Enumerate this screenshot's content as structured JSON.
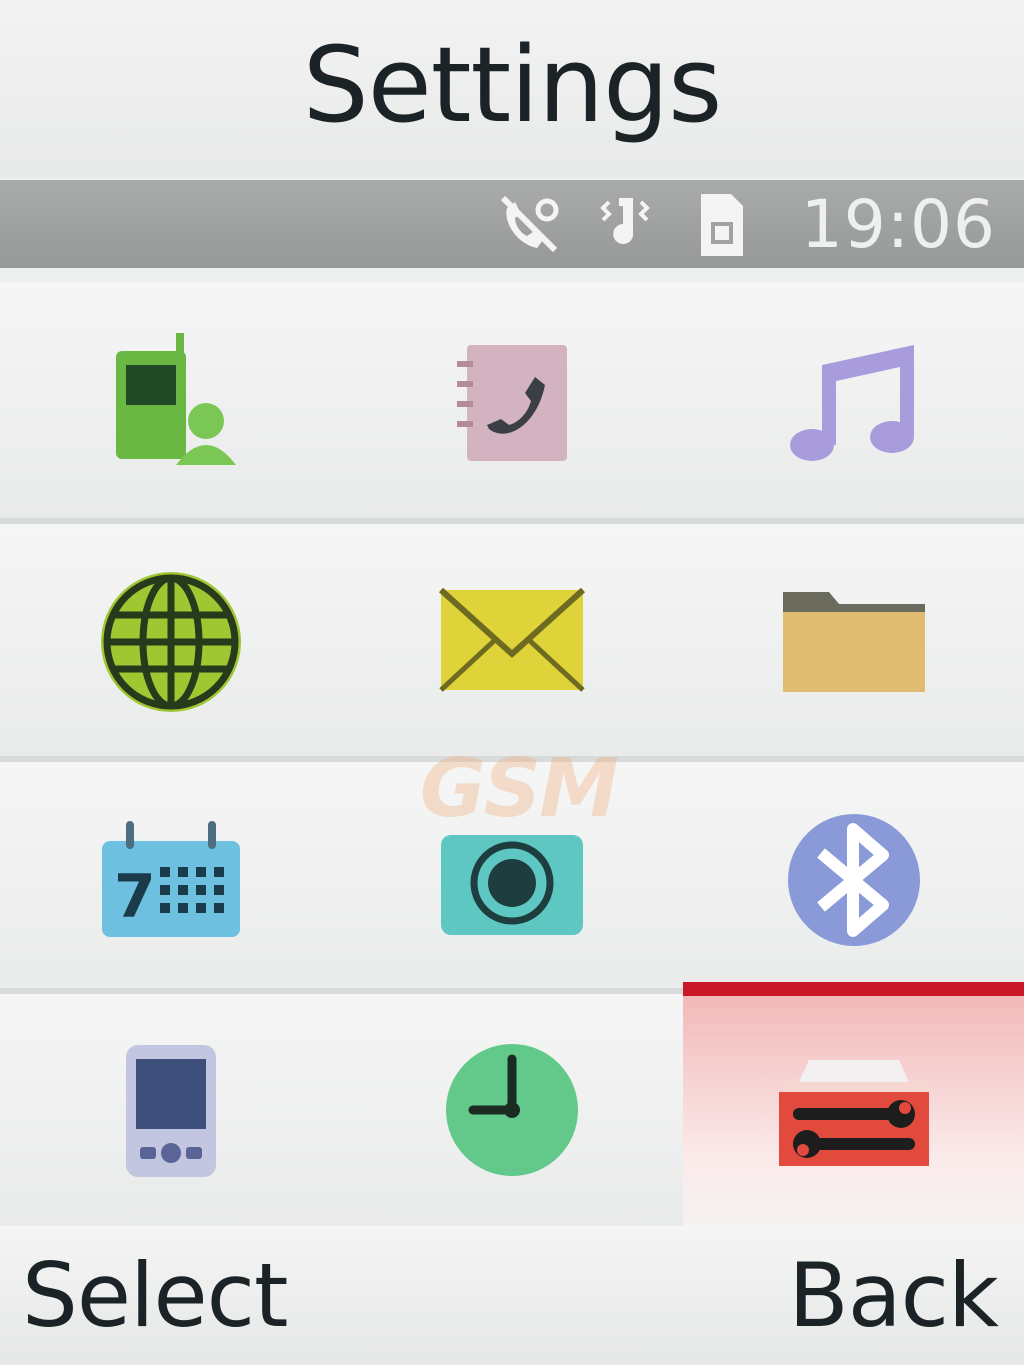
{
  "header": {
    "title": "Settings"
  },
  "status": {
    "time": "19:06",
    "icons": [
      "missed-call-icon",
      "vibrate-icon",
      "sim-card-icon"
    ]
  },
  "menu": {
    "items": [
      {
        "name": "phone-contacts-icon",
        "color": "#5fae3a"
      },
      {
        "name": "call-log-icon",
        "color": "#c9a0b0"
      },
      {
        "name": "music-icon",
        "color": "#9b8fd0"
      },
      {
        "name": "internet-globe-icon",
        "color": "#8fb82a"
      },
      {
        "name": "messages-envelope-icon",
        "color": "#d9cc2e"
      },
      {
        "name": "folder-icon",
        "color": "#d8b36a"
      },
      {
        "name": "calendar-icon",
        "color": "#5ab4d6"
      },
      {
        "name": "camera-icon",
        "color": "#56c3bf"
      },
      {
        "name": "bluetooth-icon",
        "color": "#8f9fd8"
      },
      {
        "name": "applications-icon",
        "color": "#5b66b0"
      },
      {
        "name": "clock-icon",
        "color": "#55c27b"
      },
      {
        "name": "settings-toolbox-icon",
        "color": "#e0483c"
      }
    ],
    "selected_index": 11,
    "selection_color": "#c8182a"
  },
  "watermark": "GSM",
  "softkeys": {
    "left": "Select",
    "right": "Back"
  }
}
